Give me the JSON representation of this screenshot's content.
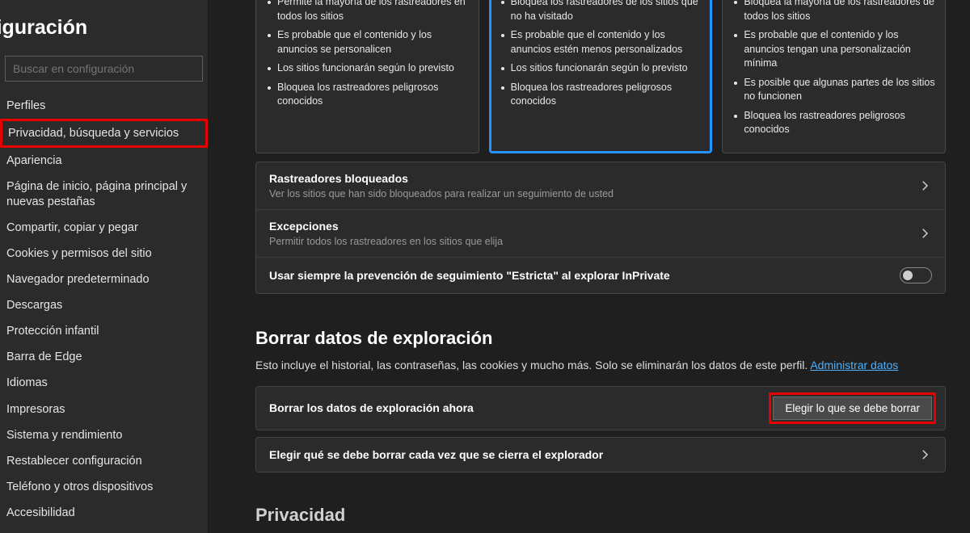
{
  "sidebar": {
    "title": "nfiguración",
    "search_placeholder": "Buscar en configuración",
    "items": [
      {
        "label": "Perfiles"
      },
      {
        "label": "Privacidad, búsqueda y servicios",
        "active": true
      },
      {
        "label": "Apariencia"
      },
      {
        "label": "Página de inicio, página principal y nuevas pestañas"
      },
      {
        "label": "Compartir, copiar y pegar"
      },
      {
        "label": "Cookies y permisos del sitio"
      },
      {
        "label": "Navegador predeterminado"
      },
      {
        "label": "Descargas"
      },
      {
        "label": "Protección infantil"
      },
      {
        "label": "Barra de Edge"
      },
      {
        "label": "Idiomas"
      },
      {
        "label": "Impresoras"
      },
      {
        "label": "Sistema y rendimiento"
      },
      {
        "label": "Restablecer configuración"
      },
      {
        "label": "Teléfono y otros dispositivos"
      },
      {
        "label": "Accesibilidad"
      }
    ]
  },
  "tracking": {
    "cards": [
      {
        "selected": false,
        "bullets": [
          "Permite la mayoría de los rastreadores en todos los sitios",
          "Es probable que el contenido y los anuncios se personalicen",
          "Los sitios funcionarán según lo previsto",
          "Bloquea los rastreadores peligrosos conocidos"
        ]
      },
      {
        "selected": true,
        "bullets": [
          "Bloquea los rastreadores de los sitios que no ha visitado",
          "Es probable que el contenido y los anuncios estén menos personalizados",
          "Los sitios funcionarán según lo previsto",
          "Bloquea los rastreadores peligrosos conocidos"
        ]
      },
      {
        "selected": false,
        "bullets": [
          "Bloquea la mayoría de los rastreadores de todos los sitios",
          "Es probable que el contenido y los anuncios tengan una personalización mínima",
          "Es posible que algunas partes de los sitios no funcionen",
          "Bloquea los rastreadores peligrosos conocidos"
        ]
      }
    ],
    "blocked_title": "Rastreadores bloqueados",
    "blocked_sub": "Ver los sitios que han sido bloqueados para realizar un seguimiento de usted",
    "exceptions_title": "Excepciones",
    "exceptions_sub": "Permitir todos los rastreadores en los sitios que elija",
    "inprivate": "Usar siempre la prevención de seguimiento \"Estricta\" al explorar InPrivate"
  },
  "clear": {
    "heading": "Borrar datos de exploración",
    "desc": "Esto incluye el historial, las contraseñas, las cookies y mucho más. Solo se eliminarán los datos de este perfil. ",
    "link": "Administrar datos",
    "now_title": "Borrar los datos de exploración ahora",
    "now_button": "Elegir lo que se debe borrar",
    "onclose_title": "Elegir qué se debe borrar cada vez que se cierra el explorador"
  },
  "privacy_heading": "Privacidad"
}
